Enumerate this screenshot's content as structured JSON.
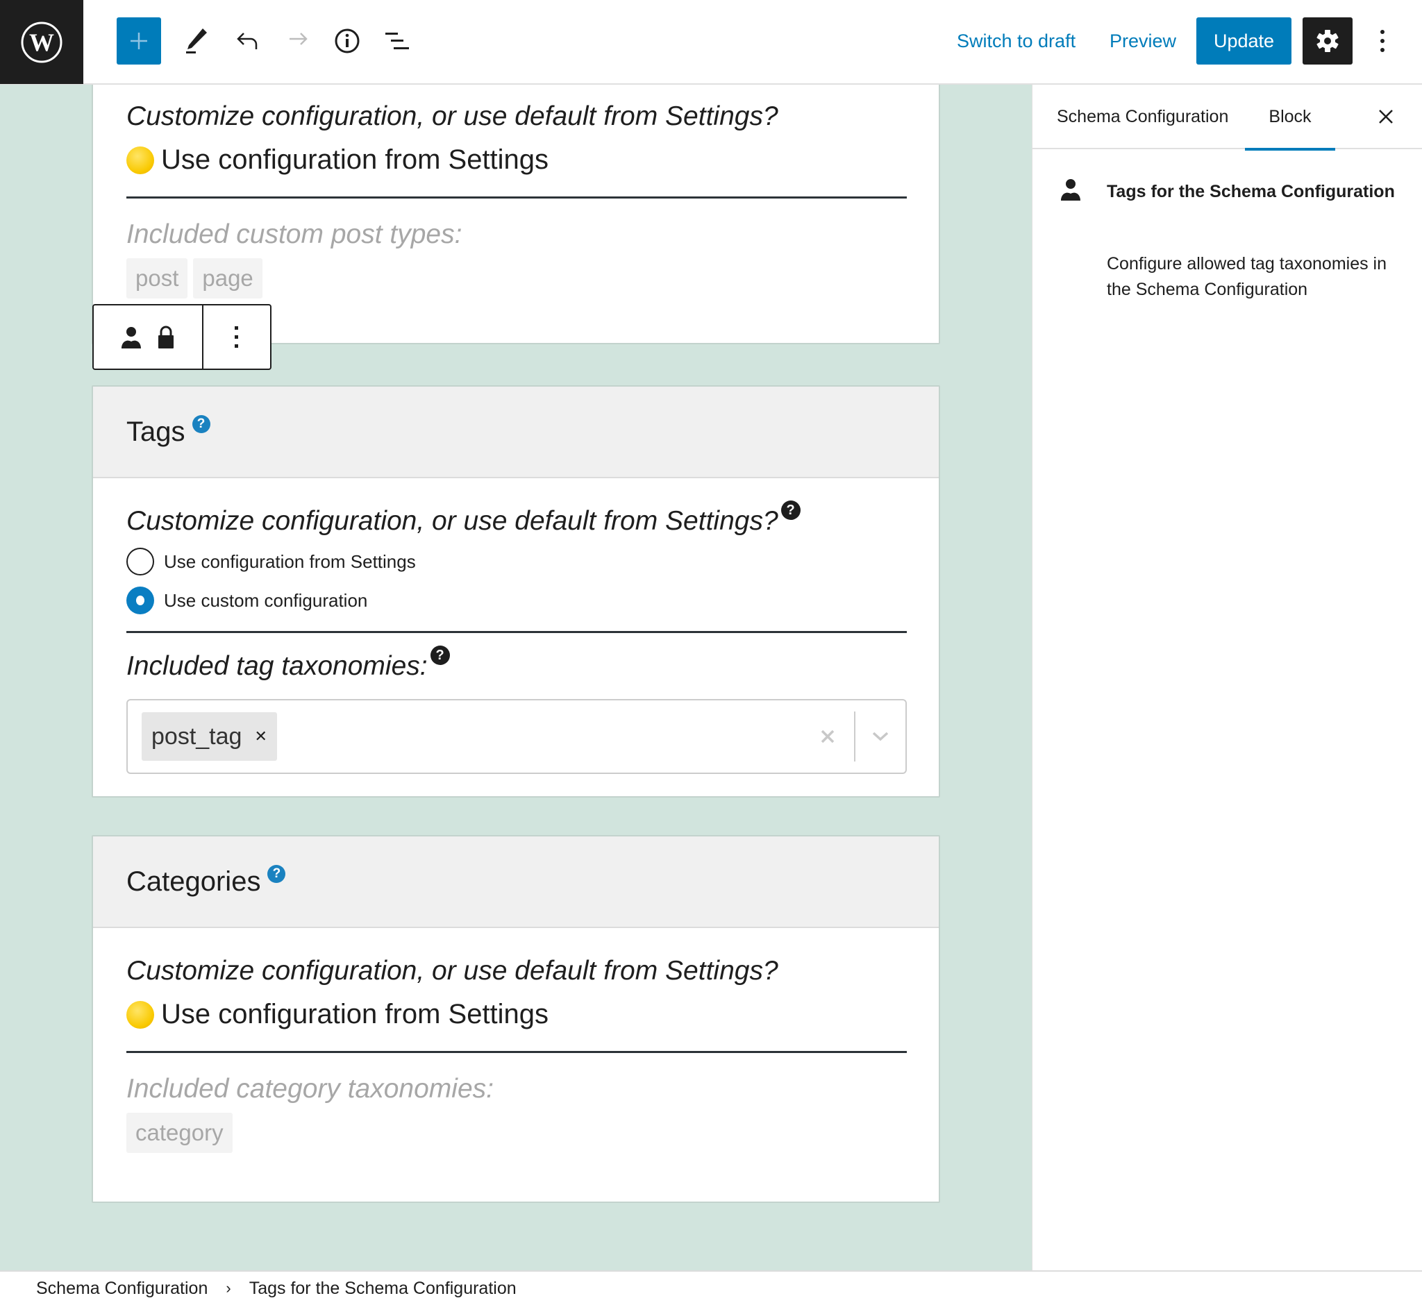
{
  "topbar": {
    "logo_icon": "wordpress-logo-icon",
    "tools": [
      {
        "name": "add-block",
        "icon": "plus-icon"
      },
      {
        "name": "tools",
        "icon": "pencil-icon"
      },
      {
        "name": "undo",
        "icon": "undo-icon"
      },
      {
        "name": "redo",
        "icon": "redo-icon"
      },
      {
        "name": "details",
        "icon": "info-icon"
      },
      {
        "name": "list-view",
        "icon": "list-view-icon"
      }
    ],
    "switch_to_draft": "Switch to draft",
    "preview": "Preview",
    "update": "Update",
    "settings_icon": "gear-icon",
    "more_icon": "more-vertical-icon"
  },
  "colors": {
    "accent": "#007cba",
    "canvas_bg": "#d1e4dd",
    "dark": "#1e1e1e",
    "muted": "#a7a7a7"
  },
  "blocks": {
    "custom_posts": {
      "question": "Customize configuration, or use default from Settings?",
      "status": "Use configuration from Settings",
      "included_label": "Included custom post types:",
      "values": [
        "post",
        "page"
      ]
    },
    "tags": {
      "title": "Tags",
      "question": "Customize configuration, or use default from Settings?",
      "options": [
        {
          "label": "Use configuration from Settings",
          "checked": false
        },
        {
          "label": "Use custom configuration",
          "checked": true
        }
      ],
      "included_label": "Included tag taxonomies:",
      "selected": [
        "post_tag"
      ]
    },
    "categories": {
      "title": "Categories",
      "question": "Customize configuration, or use default from Settings?",
      "status": "Use configuration from Settings",
      "included_label": "Included category taxonomies:",
      "values": [
        "category"
      ]
    }
  },
  "block_toolbar": {
    "icons": [
      "user-icon",
      "lock-icon"
    ],
    "options_icon": "more-vertical-icon"
  },
  "sidebar": {
    "tabs": [
      {
        "label": "Schema Configuration",
        "active": false
      },
      {
        "label": "Block",
        "active": true
      }
    ],
    "block_card": {
      "title": "Tags for the Schema Configuration",
      "description": "Configure allowed tag taxonomies in the Schema Configuration"
    }
  },
  "breadcrumb": {
    "items": [
      "Schema Configuration",
      "Tags for the Schema Configuration"
    ],
    "separator": "›"
  }
}
